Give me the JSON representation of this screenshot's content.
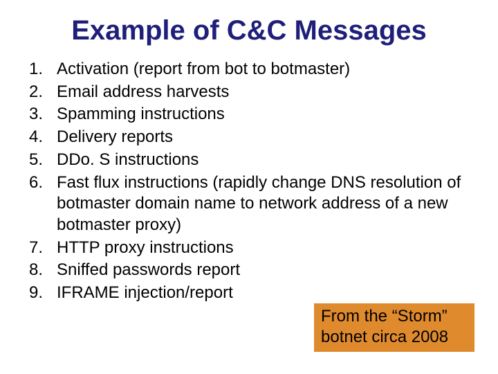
{
  "title": "Example of C&C Messages",
  "items": [
    {
      "n": "1.",
      "text": "Activation (report from bot to botmaster)"
    },
    {
      "n": "2.",
      "text": "Email address harvests"
    },
    {
      "n": "3.",
      "text": "Spamming instructions"
    },
    {
      "n": "4.",
      "text": "Delivery reports"
    },
    {
      "n": "5.",
      "text": "DDo. S instructions"
    },
    {
      "n": "6.",
      "text": "Fast flux instructions (rapidly change DNS resolution of botmaster domain name to network address of a new botmaster proxy)"
    },
    {
      "n": "7.",
      "text": "HTTP proxy instructions"
    },
    {
      "n": "8.",
      "text": "Sniffed passwords report"
    },
    {
      "n": "9.",
      "text": "IFRAME injection/report"
    }
  ],
  "callout": "From the “Storm” botnet circa 2008"
}
